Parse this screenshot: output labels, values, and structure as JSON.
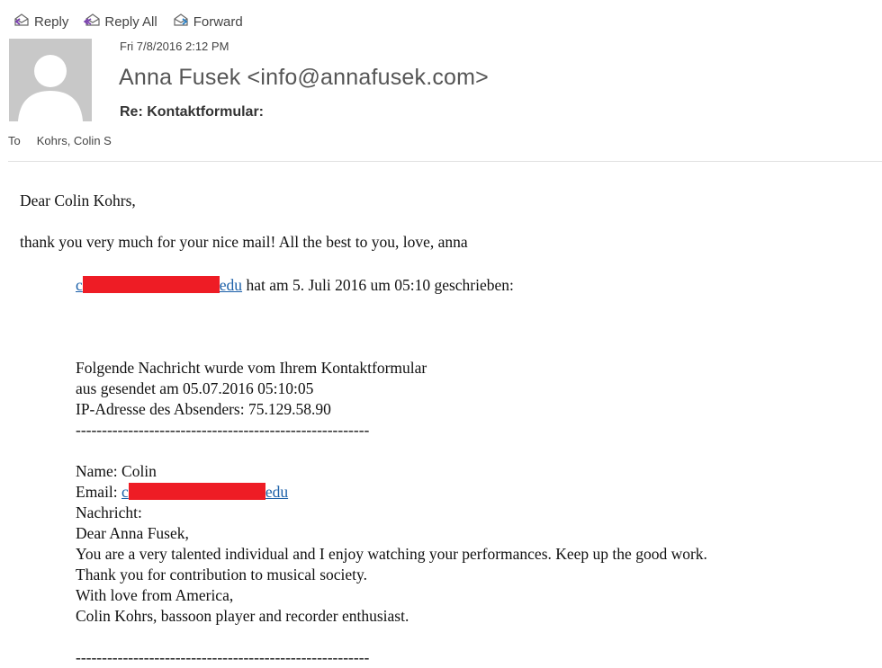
{
  "toolbar": {
    "reply_label": "Reply",
    "reply_all_label": "Reply All",
    "forward_label": "Forward"
  },
  "header": {
    "date": "Fri 7/8/2016 2:12 PM",
    "sender": "Anna Fusek <info@annafusek.com>",
    "subject": "Re: Kontaktformular:",
    "to_label": "To",
    "to_value": "Kohrs, Colin S"
  },
  "body": {
    "greeting": "Dear Colin Kohrs,",
    "reply_text": "thank you very much for your nice mail! All the best to you, love, anna",
    "quote_link_start": "c",
    "quote_link_end": "edu",
    "quote_header_rest": " hat am 5. Juli 2016 um 05:10 geschrieben:",
    "quoted": {
      "line1": "Folgende Nachricht wurde vom Ihrem Kontaktformular",
      "line2": "aus gesendet am 05.07.2016 05:10:05",
      "line3": "IP-Adresse des Absenders: 75.129.58.90",
      "separator": "--------------------------------------------------------",
      "name": "Name: Colin",
      "email_label": "Email: ",
      "email_start": "c",
      "email_end": "edu",
      "message_label": "Nachricht:",
      "msg1": "Dear Anna Fusek,",
      "msg2": "You are a very talented individual and I enjoy watching your performances. Keep up the good work.",
      "msg3": "Thank you for contribution to musical society.",
      "msg4": "With love from America,",
      "msg5": "Colin Kohrs, bassoon player and recorder enthusiast.",
      "separator2": "--------------------------------------------------------"
    }
  },
  "colors": {
    "link": "#1a5fa8",
    "redaction": "#ee1c25",
    "avatar_bg": "#c8c8c8"
  }
}
